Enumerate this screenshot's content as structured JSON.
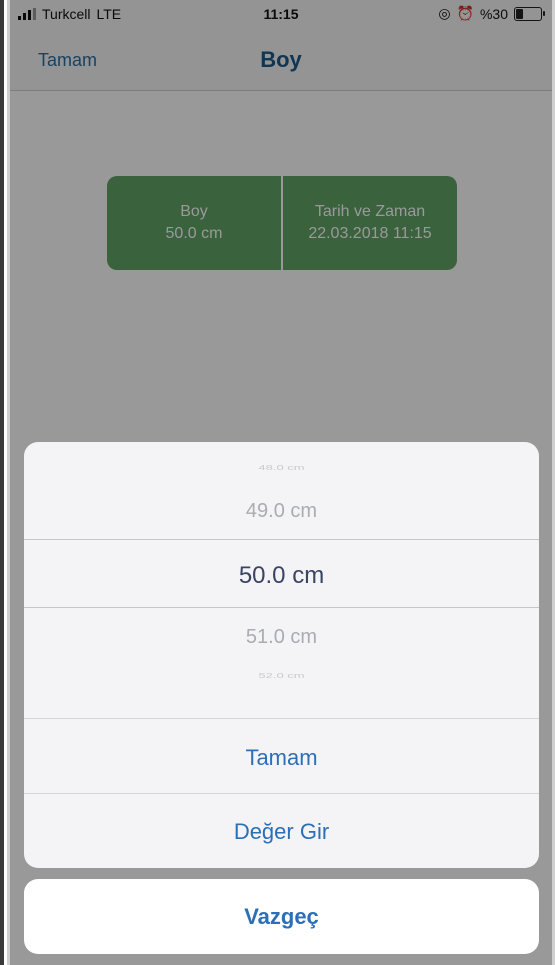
{
  "status_bar": {
    "carrier": "Turkcell",
    "network": "LTE",
    "time": "11:15",
    "battery": "%30",
    "icons": [
      "signal-icon",
      "location-icon",
      "alarm-icon",
      "battery-icon"
    ]
  },
  "nav": {
    "back_label": "Tamam",
    "title": "Boy"
  },
  "card": {
    "left_title": "Boy",
    "left_value": "50.0 cm",
    "right_title": "Tarih ve Zaman",
    "right_value": "22.03.2018 11:15"
  },
  "picker": {
    "items": [
      "48.0 cm",
      "49.0 cm",
      "50.0 cm",
      "51.0 cm",
      "52.0 cm"
    ],
    "selected": "50.0 cm"
  },
  "actions": {
    "confirm_label": "Tamam",
    "enter_value_label": "Değer Gir",
    "cancel_label": "Vazgeç"
  },
  "colors": {
    "accent": "#2c6fb5",
    "card_green": "#5fa366",
    "nav_title": "#1d5a8a"
  }
}
